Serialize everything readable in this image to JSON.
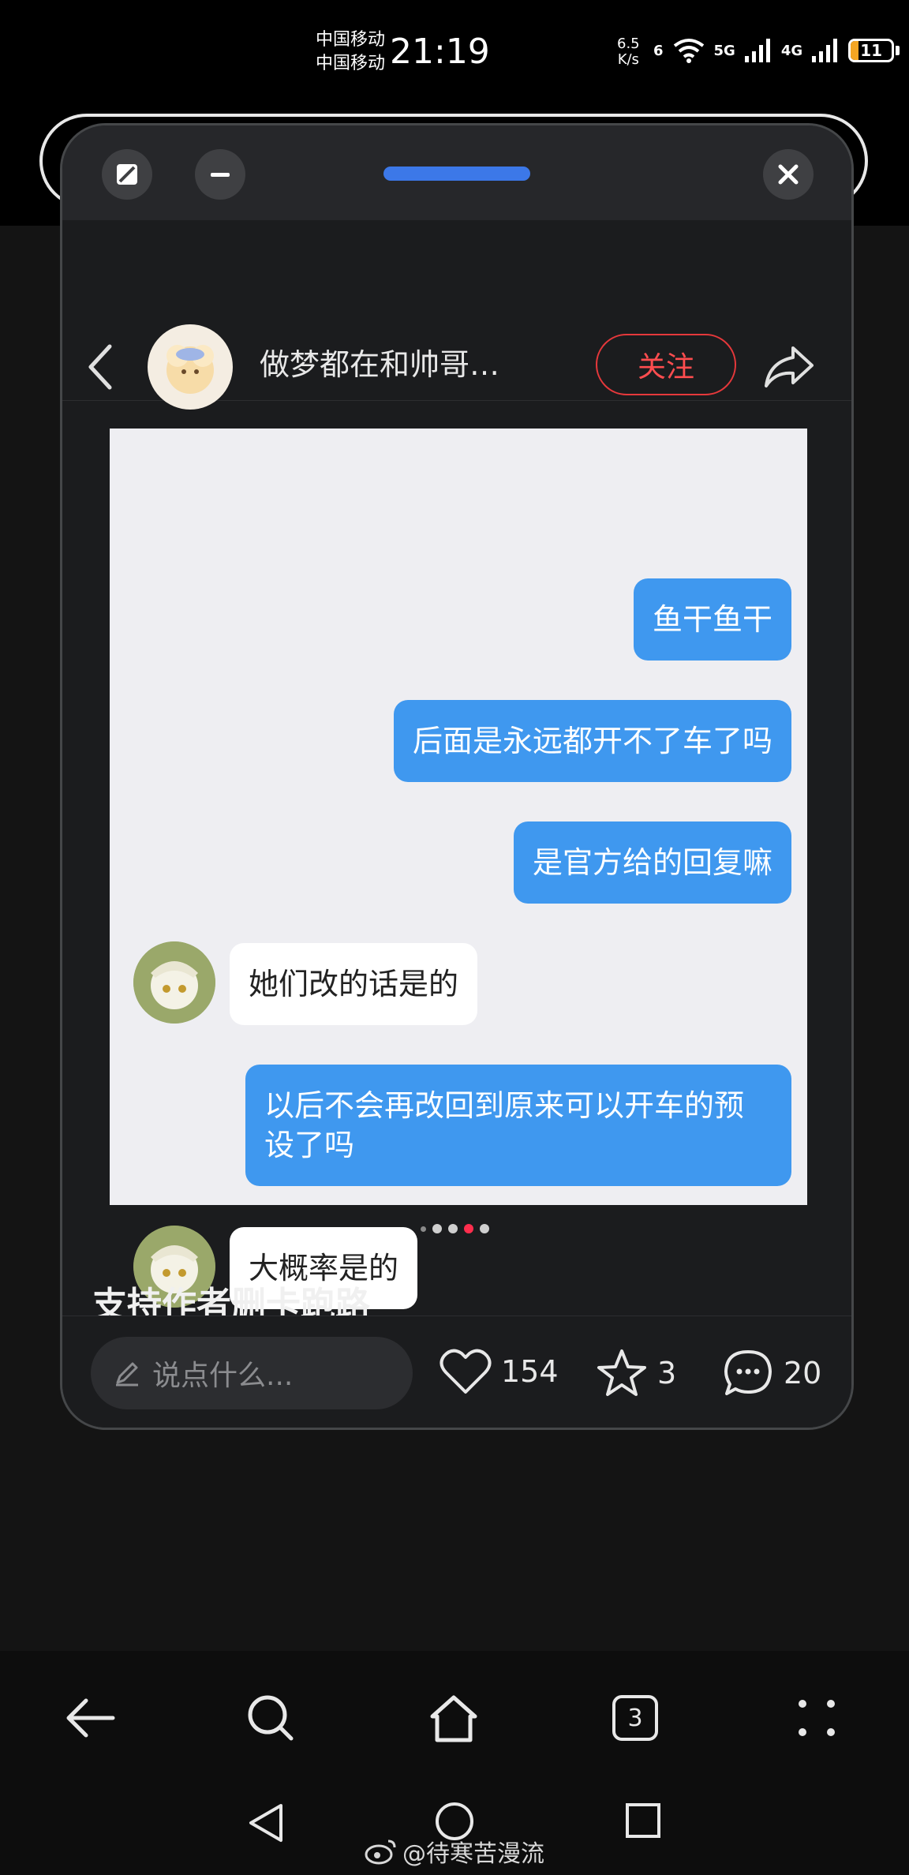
{
  "status_bar": {
    "carrier_1": "中国移动",
    "carrier_2": "中国移动",
    "time": "21:19",
    "net_speed_value": "6.5",
    "net_speed_unit": "K/s",
    "wifi_label": "6",
    "sim1_type": "5G",
    "sim2_type": "4G",
    "battery": "11"
  },
  "floating_window": {
    "header": {
      "author": "做梦都在和帅哥…",
      "follow_label": "关注"
    },
    "chat": [
      {
        "side": "me",
        "text": "鱼干鱼干"
      },
      {
        "side": "me",
        "text": "后面是永远都开不了车了吗"
      },
      {
        "side": "me",
        "text": "是官方给的回复嘛"
      },
      {
        "side": "them",
        "text": "她们改的话是的"
      },
      {
        "side": "me",
        "text": "以后不会再改回到原来可以开车的预设了吗"
      },
      {
        "side": "them",
        "text": "大概率是的"
      }
    ],
    "carousel": {
      "count": 5,
      "active": 3
    },
    "post_title": "支持作者删卡跑路",
    "bottom_bar": {
      "comment_placeholder": "说点什么...",
      "likes": "154",
      "favorites": "3",
      "comments": "20"
    }
  },
  "browser_bar": {
    "tab_count": "3"
  },
  "watermark": "@待寒苦漫流",
  "colors": {
    "accent_blue": "#3f98ef",
    "follow_red": "#ff4d4f",
    "active_dot": "#ff2e4d",
    "battery": "#f5a623"
  }
}
